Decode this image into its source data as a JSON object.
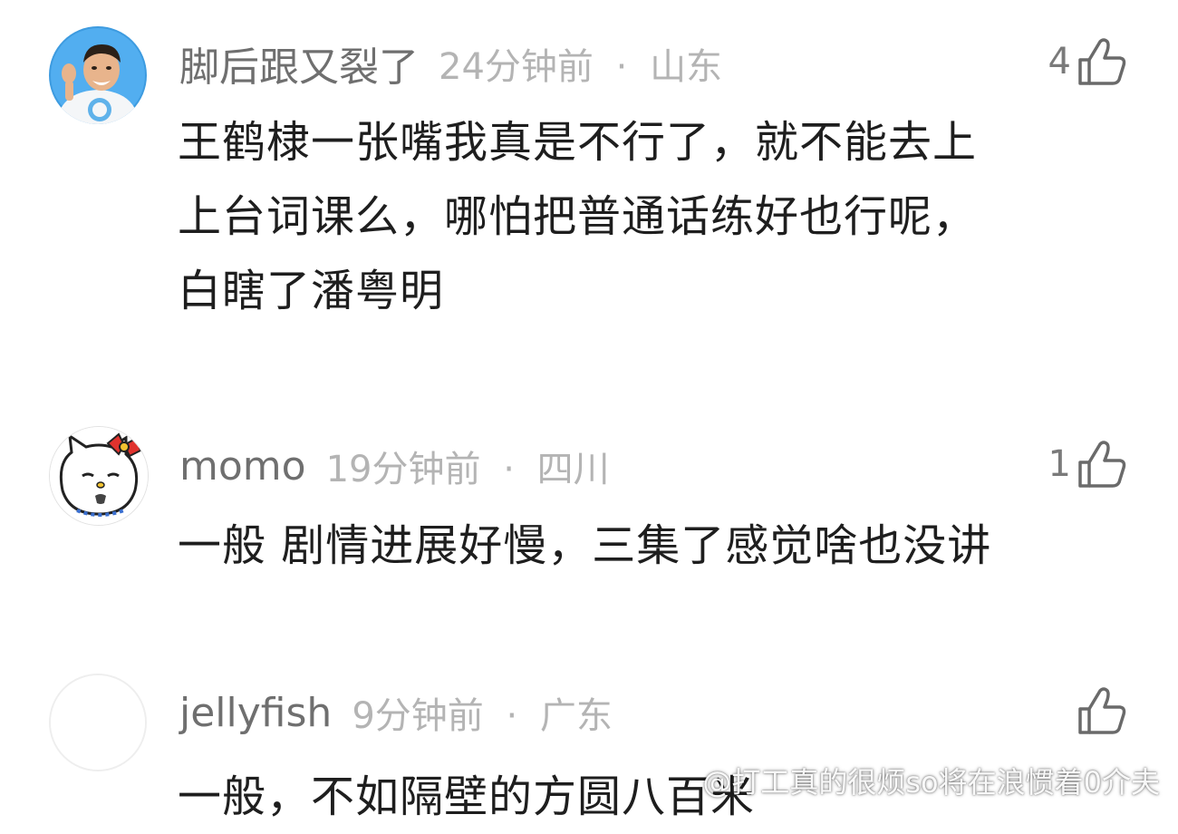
{
  "comments": [
    {
      "username": "脚后跟又裂了",
      "time": "24分钟前",
      "location": "山东",
      "likes": "4",
      "text": "王鹤棣一张嘴我真是不行了，就不能去上\n上台词课么，哪怕把普通话练好也行呢，\n白瞎了潘粤明",
      "avatar_icon": "person-avatar-icon"
    },
    {
      "username": "momo",
      "time": "19分钟前",
      "location": "四川",
      "likes": "1",
      "text": "一般 剧情进展好慢，三集了感觉啥也没讲",
      "avatar_icon": "hello-kitty-avatar-icon"
    },
    {
      "username": "jellyfish",
      "time": "9分钟前",
      "location": "广东",
      "likes": "",
      "text": "一般，不如隔壁的方圆八百米",
      "avatar_icon": "blank-avatar-icon"
    }
  ],
  "separator": "·",
  "watermark": "@打工真的很烦so将在浪惯着0介夫",
  "colors": {
    "username": "#6f6f6f",
    "meta": "#b4b4b4",
    "body": "#1e1e1e",
    "icon": "#6a6a6a"
  }
}
